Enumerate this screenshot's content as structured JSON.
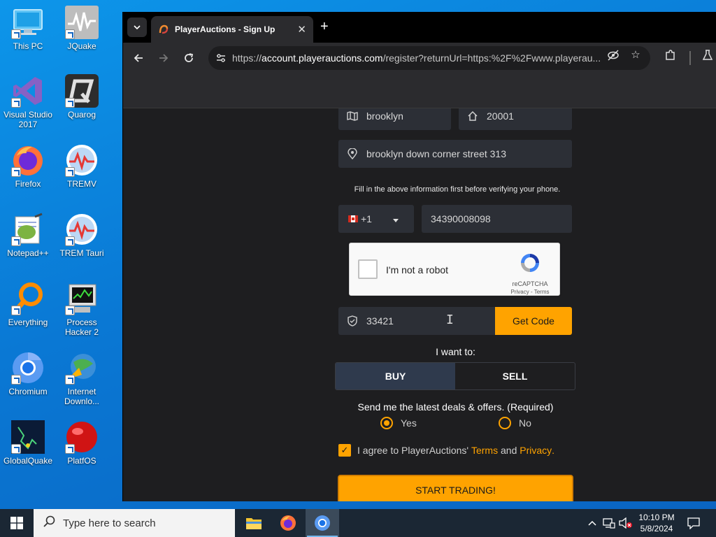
{
  "desktop": {
    "icons": [
      {
        "label": "This PC",
        "icon": "computer-icon"
      },
      {
        "label": "JQuake",
        "icon": "jquake-icon"
      },
      {
        "label": "Visual Studio 2017",
        "icon": "visual-studio-icon"
      },
      {
        "label": "Quarog",
        "icon": "quarog-icon"
      },
      {
        "label": "Firefox",
        "icon": "firefox-icon"
      },
      {
        "label": "TREMV",
        "icon": "tremv-icon"
      },
      {
        "label": "Notepad++",
        "icon": "notepadpp-icon"
      },
      {
        "label": "TREM Tauri",
        "icon": "trem-tauri-icon"
      },
      {
        "label": "Everything",
        "icon": "everything-icon"
      },
      {
        "label": "Process Hacker 2",
        "icon": "process-hacker-icon"
      },
      {
        "label": "Chromium",
        "icon": "chromium-icon"
      },
      {
        "label": "Internet Downlo...",
        "icon": "internet-download-manager-icon"
      },
      {
        "label": "GlobalQuake",
        "icon": "globalquake-icon"
      },
      {
        "label": "PlatfOS",
        "icon": "platfos-icon"
      }
    ]
  },
  "browser": {
    "tab_title": "PlayerAuctions - Sign Up",
    "url_prefix": "https://",
    "url_host": "account.playerauctions.com",
    "url_rest": "/register?returnUrl=https:%2F%2Fwww.playerau..."
  },
  "form": {
    "city_value": "brooklyn",
    "zip_value": "20001",
    "address_value": "brooklyn down corner street 313",
    "hint": "Fill in the above information first before verifying your phone.",
    "country_code": "+1",
    "phone_value": "34390008098",
    "captcha_label": "I'm not a robot",
    "captcha_brand": "reCAPTCHA",
    "captcha_links": "Privacy - Terms",
    "code_value": "33421",
    "get_code_label": "Get Code",
    "want_label": "I want to:",
    "buy_label": "BUY",
    "sell_label": "SELL",
    "deals_label": "Send me the latest deals & offers. (Required)",
    "yes_label": "Yes",
    "no_label": "No",
    "agree_prefix": "I agree to PlayerAuctions'",
    "terms_link": "Terms",
    "and_text": "and",
    "privacy_link": "Privacy",
    "agree_suffix": ".",
    "start_label": "START TRADING!"
  },
  "taskbar": {
    "search_placeholder": "Type here to search",
    "time": "10:10 PM",
    "date": "5/8/2024"
  },
  "colors": {
    "accent": "#ffa300",
    "page_bg": "#1e1e20",
    "field_bg": "#2c2f36"
  }
}
